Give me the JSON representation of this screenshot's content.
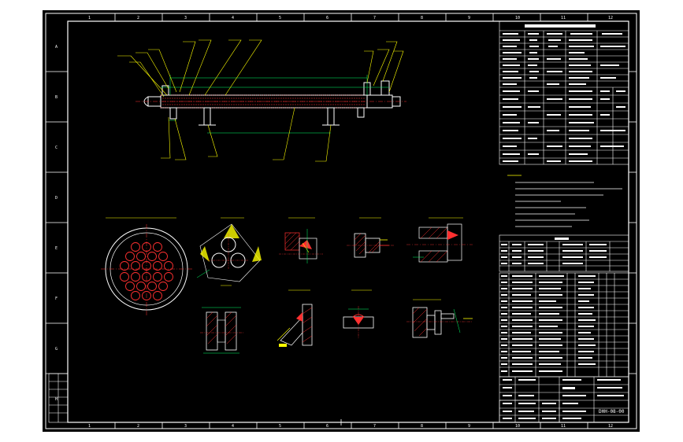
{
  "colors": {
    "background": "#000000",
    "border": "#ffffff",
    "geometry": "#ffffff",
    "annotation": "#ffff00",
    "centerline": "#ff3030",
    "dimension": "#00ff66",
    "hatch": "#ff3030",
    "text": "#ffffff"
  },
  "grid": {
    "top_numbers": [
      "1",
      "2",
      "3",
      "4",
      "5",
      "6",
      "7",
      "8",
      "9",
      "10",
      "11",
      "12"
    ],
    "bottom_numbers": [
      "1",
      "2",
      "3",
      "4",
      "5",
      "6",
      "7",
      "8",
      "9",
      "10",
      "11",
      "12"
    ],
    "side_letters": [
      "A",
      "B",
      "C",
      "D",
      "E",
      "F",
      "G",
      "H"
    ]
  },
  "title_block": {
    "drawing_no": "DHH-08-00"
  }
}
